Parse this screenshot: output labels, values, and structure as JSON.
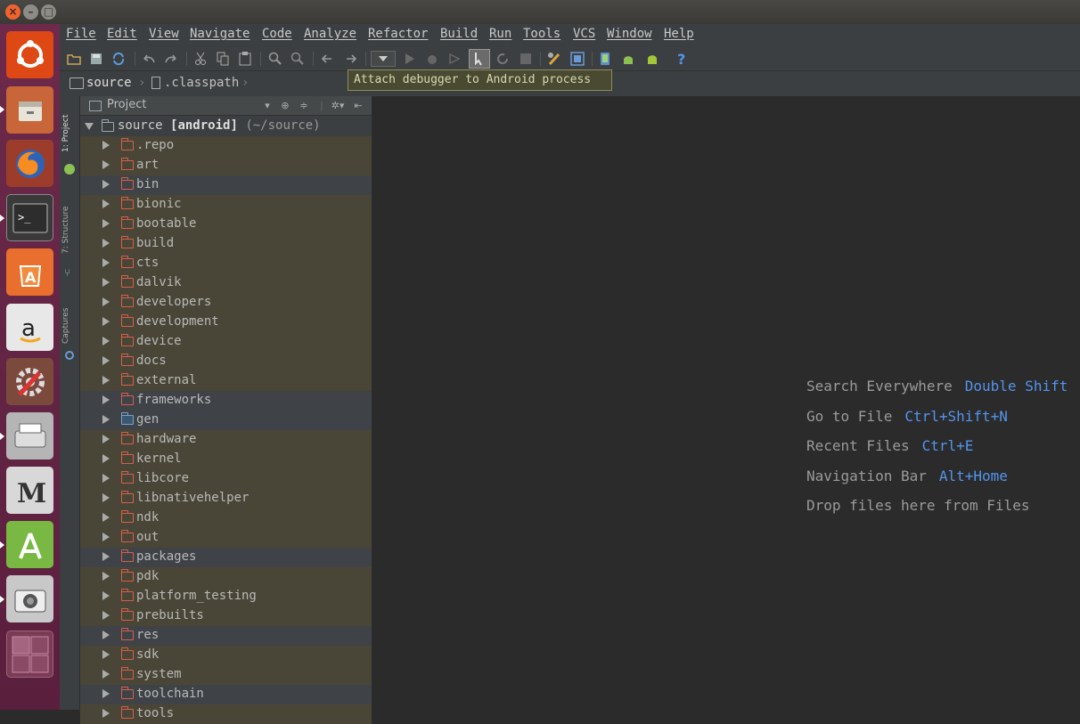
{
  "window": {
    "close": "×",
    "minimize": "–",
    "maximize": "□"
  },
  "launcher": {
    "items": [
      "ubuntu-dash",
      "files",
      "firefox",
      "terminal",
      "software-center",
      "amazon",
      "system-settings",
      "scanner",
      "m-editor",
      "android-studio",
      "camera",
      "workspace-switcher"
    ]
  },
  "menu": [
    "File",
    "Edit",
    "View",
    "Navigate",
    "Code",
    "Analyze",
    "Refactor",
    "Build",
    "Run",
    "Tools",
    "VCS",
    "Window",
    "Help"
  ],
  "breadcrumb": {
    "root": "source",
    "file": ".classpath"
  },
  "tooltip": "Attach debugger to Android process",
  "sidebar_tabs": {
    "project": "1: Project",
    "structure": "7: Structure",
    "captures": "Captures"
  },
  "project": {
    "title": "Project",
    "root": {
      "name": "source",
      "module": "[android]",
      "path": "(~/source)"
    },
    "items": [
      ".repo",
      "art",
      "bin",
      "bionic",
      "bootable",
      "build",
      "cts",
      "dalvik",
      "developers",
      "development",
      "device",
      "docs",
      "external",
      "frameworks",
      "gen",
      "hardware",
      "kernel",
      "libcore",
      "libnativehelper",
      "ndk",
      "out",
      "packages",
      "pdk",
      "platform_testing",
      "prebuilts",
      "res",
      "sdk",
      "system",
      "toolchain",
      "tools"
    ]
  },
  "editor": {
    "hints": [
      {
        "label": "Search Everywhere",
        "key": "Double Shift"
      },
      {
        "label": "Go to File",
        "key": "Ctrl+Shift+N"
      },
      {
        "label": "Recent Files",
        "key": "Ctrl+E"
      },
      {
        "label": "Navigation Bar",
        "key": "Alt+Home"
      }
    ],
    "drop_text": "Drop files here from Files"
  },
  "colors": {
    "folder": "#d55f4b",
    "shortcut": "#5394ec",
    "launcher": "#5a1f3d"
  }
}
